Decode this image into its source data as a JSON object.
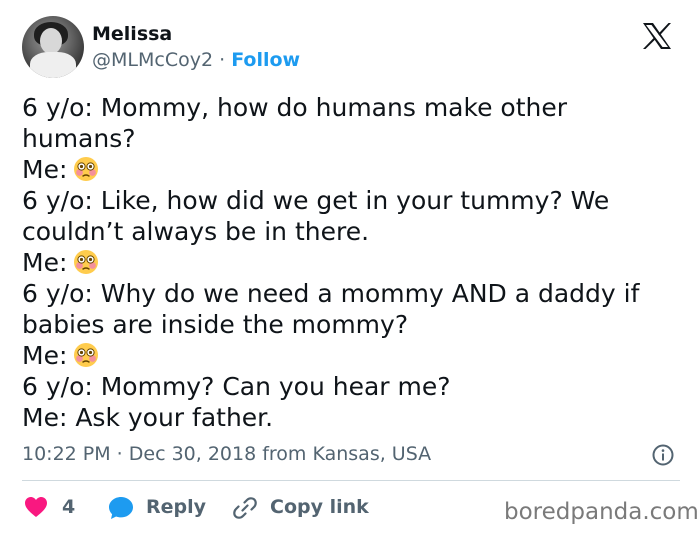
{
  "author": {
    "name": "Melissa",
    "handle": "@MLMcCoy2",
    "separator": "·",
    "follow_label": "Follow",
    "avatar_icon": "profile-photo"
  },
  "platform_icon": "x-logo",
  "tweet": {
    "lines": [
      {
        "text": "6 y/o: Mommy, how do humans make other",
        "emoji": ""
      },
      {
        "text": "humans?",
        "emoji": ""
      },
      {
        "text": "Me:",
        "emoji": "flushed-face"
      },
      {
        "text": "6 y/o: Like, how did we get in your tummy? We",
        "emoji": ""
      },
      {
        "text": "couldn’t always be in there.",
        "emoji": ""
      },
      {
        "text": "Me:",
        "emoji": "flushed-face"
      },
      {
        "text": "6 y/o: Why do we need a mommy AND a daddy if",
        "emoji": ""
      },
      {
        "text": "babies are inside the mommy?",
        "emoji": ""
      },
      {
        "text": "Me:",
        "emoji": "flushed-face"
      },
      {
        "text": "6 y/o: Mommy? Can you hear me?",
        "emoji": ""
      },
      {
        "text": "Me: Ask your father.",
        "emoji": ""
      }
    ]
  },
  "meta": {
    "timestamp": "10:22 PM · Dec 30, 2018 from Kansas, USA"
  },
  "actions": {
    "like_count": "4",
    "reply_label": "Reply",
    "copy_link_label": "Copy link"
  },
  "watermark": "boredpanda.com",
  "colors": {
    "accent": "#1d9bf0",
    "like": "#f91880",
    "muted": "#536471",
    "text": "#0f1419"
  }
}
